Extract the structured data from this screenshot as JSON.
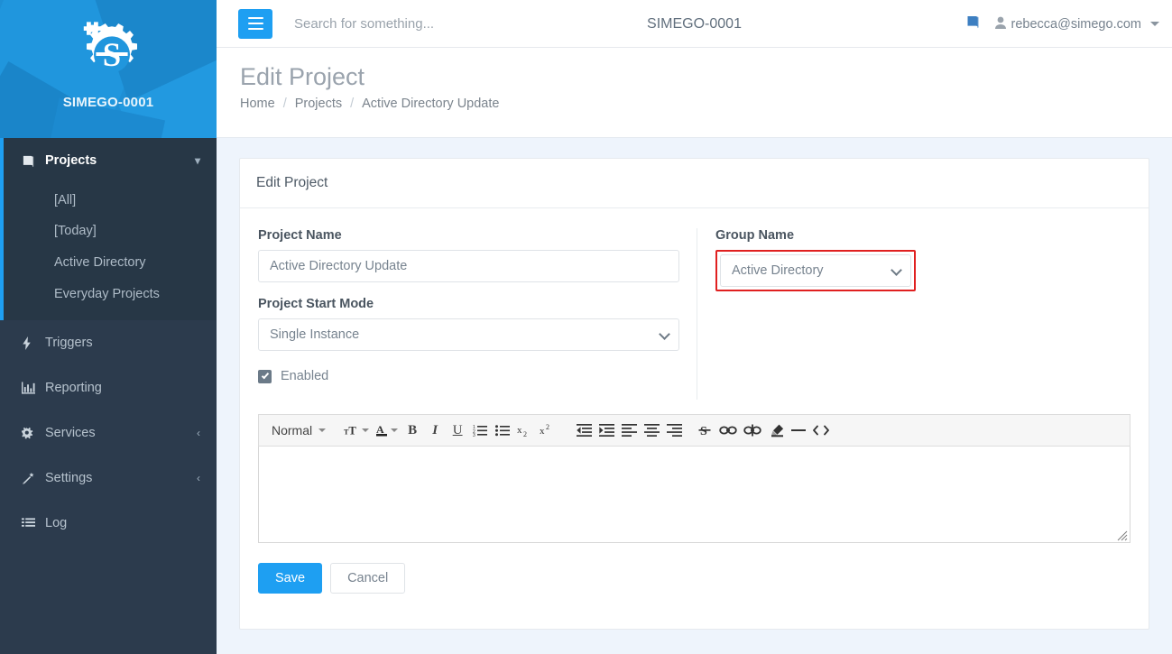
{
  "brand": {
    "name": "SIMEGO-0001",
    "logo_icon": "gear-s-logo-icon"
  },
  "sidebar": {
    "projects": {
      "label": "Projects",
      "icon": "book-icon",
      "chevron": "chevron-down-icon",
      "children": [
        {
          "label": "[All]"
        },
        {
          "label": "[Today]"
        },
        {
          "label": "Active Directory"
        },
        {
          "label": "Everyday Projects"
        }
      ]
    },
    "items": [
      {
        "label": "Triggers",
        "icon": "bolt-icon",
        "chevron": ""
      },
      {
        "label": "Reporting",
        "icon": "bar-chart-icon",
        "chevron": ""
      },
      {
        "label": "Services",
        "icon": "cogs-icon",
        "chevron": "chevron-left-icon"
      },
      {
        "label": "Settings",
        "icon": "magic-wand-icon",
        "chevron": "chevron-left-icon"
      },
      {
        "label": "Log",
        "icon": "list-icon",
        "chevron": ""
      }
    ]
  },
  "topbar": {
    "menu_toggle_icon": "hamburger-icon",
    "search_placeholder": "Search for something...",
    "search_value": "",
    "title": "SIMEGO-0001",
    "book_icon": "book-icon",
    "user_icon": "user-icon",
    "user_email": "rebecca@simego.com",
    "caret_icon": "caret-down-icon"
  },
  "page": {
    "title": "Edit Project",
    "breadcrumb": [
      {
        "label": "Home"
      },
      {
        "label": "Projects"
      },
      {
        "label": "Active Directory Update"
      }
    ],
    "breadcrumb_separator": "/"
  },
  "card": {
    "title": "Edit Project",
    "fields": {
      "project_name": {
        "label": "Project Name",
        "value": "Active Directory Update",
        "placeholder": "Project Name"
      },
      "project_start_mode": {
        "label": "Project Start Mode",
        "value": "Single Instance"
      },
      "group_name": {
        "label": "Group Name",
        "value": "Active Directory",
        "highlight_color": "#e02020"
      },
      "enabled": {
        "label": "Enabled",
        "checked": true
      }
    },
    "editor": {
      "format_select": "Normal",
      "content": "",
      "tools": [
        {
          "name": "font-size-icon",
          "glyph": "ᴛT"
        },
        {
          "name": "text-color-icon",
          "glyph": "A"
        },
        {
          "name": "bold-icon",
          "glyph": "B"
        },
        {
          "name": "italic-icon",
          "glyph": "I"
        },
        {
          "name": "underline-icon",
          "glyph": "U"
        },
        {
          "name": "ordered-list-icon",
          "glyph": ""
        },
        {
          "name": "bullet-list-icon",
          "glyph": ""
        },
        {
          "name": "subscript-icon",
          "glyph": "x₂"
        },
        {
          "name": "superscript-icon",
          "glyph": "x²"
        },
        {
          "name": "outdent-icon",
          "glyph": ""
        },
        {
          "name": "indent-icon",
          "glyph": ""
        },
        {
          "name": "align-left-icon",
          "glyph": ""
        },
        {
          "name": "align-center-icon",
          "glyph": ""
        },
        {
          "name": "align-right-icon",
          "glyph": ""
        },
        {
          "name": "strikethrough-icon",
          "glyph": "S"
        },
        {
          "name": "link-icon",
          "glyph": "∞"
        },
        {
          "name": "unlink-icon",
          "glyph": "∞"
        },
        {
          "name": "clear-format-icon",
          "glyph": ""
        },
        {
          "name": "horizontal-rule-icon",
          "glyph": "—"
        },
        {
          "name": "code-icon",
          "glyph": "<>"
        }
      ]
    },
    "buttons": {
      "save": "Save",
      "cancel": "Cancel"
    }
  },
  "colors": {
    "accent": "#1e9ff2",
    "sidebar": "#2c3b4d",
    "sidebar_active": "#273746",
    "brand_blue": "#1e8fd5",
    "content_bg": "#eef4fc",
    "highlight_red": "#e02020"
  }
}
